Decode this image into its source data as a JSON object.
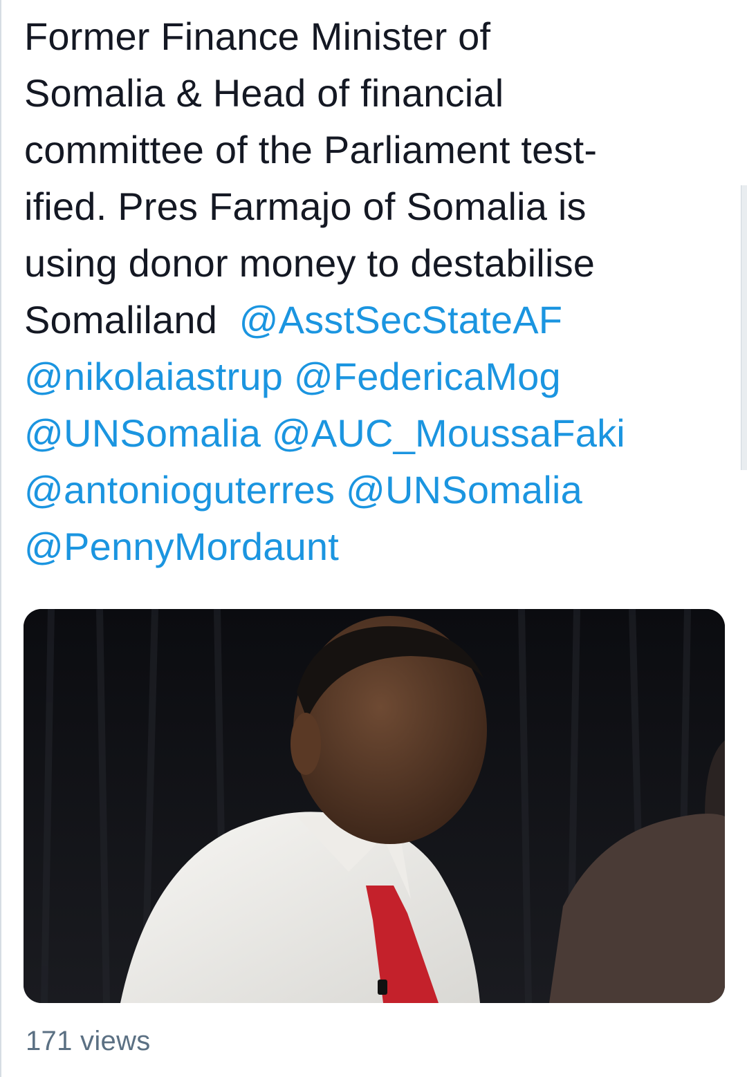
{
  "tweet": {
    "lines": [
      [
        {
          "text": "Former Finance Minister of"
        }
      ],
      [
        {
          "text": "Somalia & Head of financial"
        }
      ],
      [
        {
          "text": "committee of the Parliament test-"
        }
      ],
      [
        {
          "text": "ified. Pres Farmajo of Somalia is"
        }
      ],
      [
        {
          "text": "using donor money to destabilise"
        }
      ],
      [
        {
          "text": "Somaliland  "
        },
        {
          "text": "@AsstSecStateAF",
          "mention": true
        }
      ],
      [
        {
          "text": "@nikolaiastrup",
          "mention": true
        },
        {
          "text": " "
        },
        {
          "text": "@FedericaMog",
          "mention": true
        }
      ],
      [
        {
          "text": "@UNSomalia",
          "mention": true
        },
        {
          "text": " "
        },
        {
          "text": "@AUC_MoussaFaki",
          "mention": true
        }
      ],
      [
        {
          "text": "@antonioguterres",
          "mention": true
        },
        {
          "text": " "
        },
        {
          "text": "@UNSomalia",
          "mention": true
        }
      ],
      [
        {
          "text": "@PennyMordaunt",
          "mention": true
        }
      ]
    ]
  },
  "media": {
    "type": "video",
    "subject": "man in white shirt and red tie speaking at a panel, dark curtain background"
  },
  "footer": {
    "views": "171 views"
  },
  "colors": {
    "text": "#141823",
    "mention": "#1b95e0",
    "secondary": "#5b7083"
  }
}
